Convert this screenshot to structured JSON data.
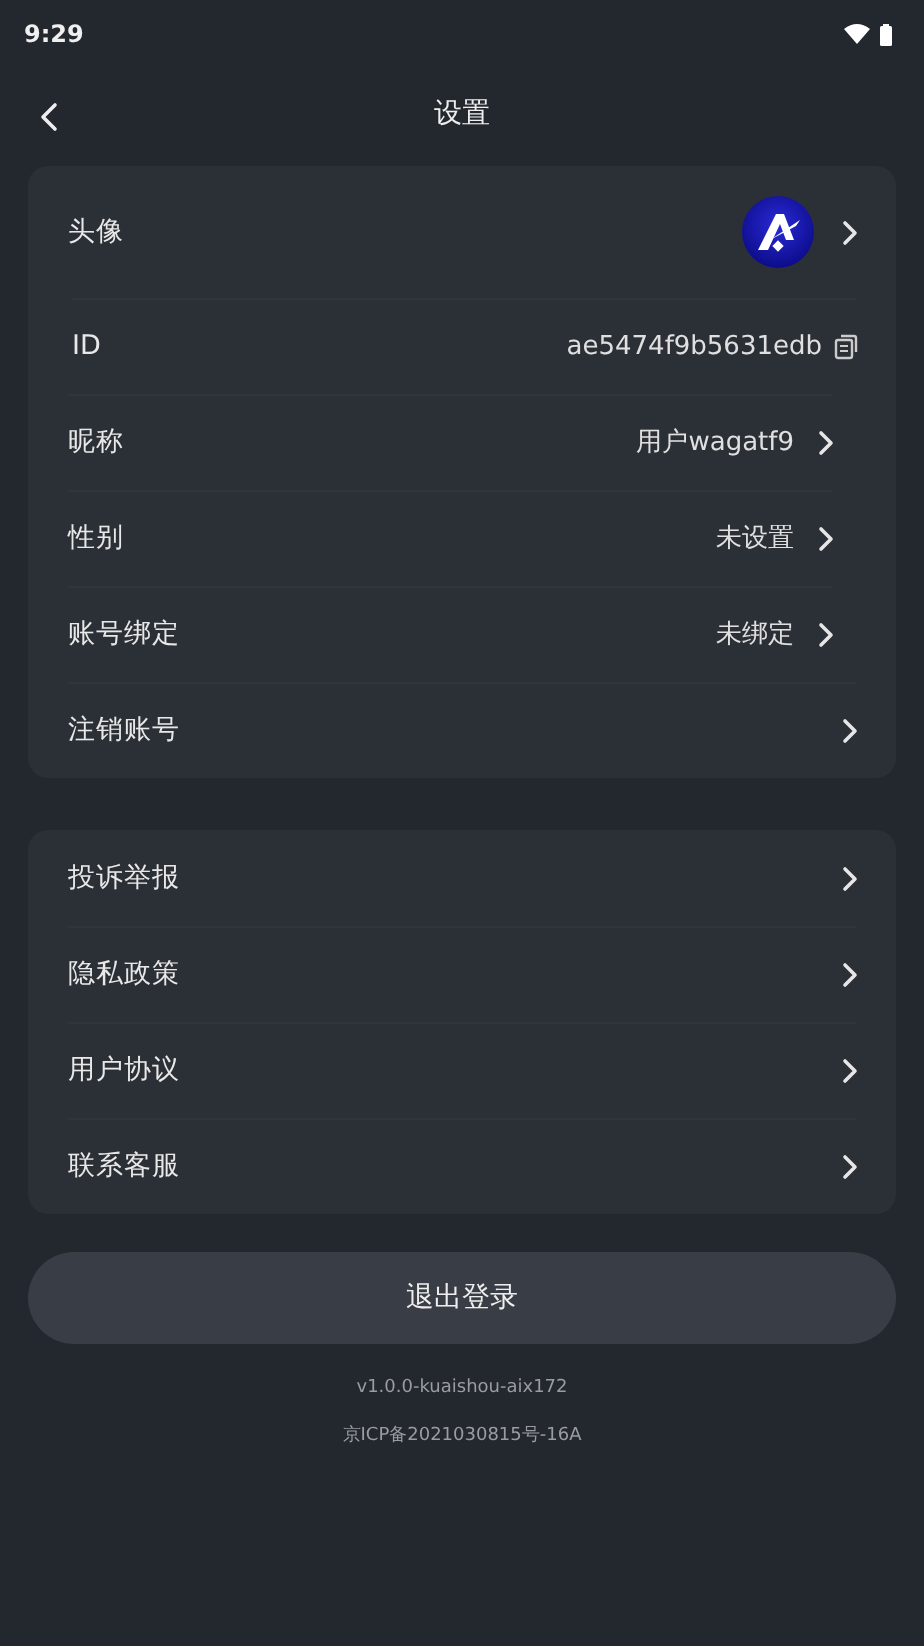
{
  "status_bar": {
    "time": "9:29"
  },
  "header": {
    "title": "设置"
  },
  "account_section": [
    {
      "kind": "avatar",
      "label": "头像"
    },
    {
      "kind": "copy",
      "label": "ID",
      "value": "ae5474f9b5631edb"
    },
    {
      "kind": "value",
      "label": "昵称",
      "value": "用户wagatf9"
    },
    {
      "kind": "value",
      "label": "性别",
      "value": "未设置"
    },
    {
      "kind": "value",
      "label": "账号绑定",
      "value": "未绑定"
    },
    {
      "kind": "plain",
      "label": "注销账号"
    }
  ],
  "info_section": [
    {
      "kind": "plain",
      "label": "投诉举报"
    },
    {
      "kind": "plain",
      "label": "隐私政策"
    },
    {
      "kind": "plain",
      "label": "用户协议"
    },
    {
      "kind": "plain",
      "label": "联系客服"
    }
  ],
  "logout_button": "退出登录",
  "version": "v1.0.0-kuaishou-aix172",
  "icp": "京ICP备2021030815号-16A"
}
